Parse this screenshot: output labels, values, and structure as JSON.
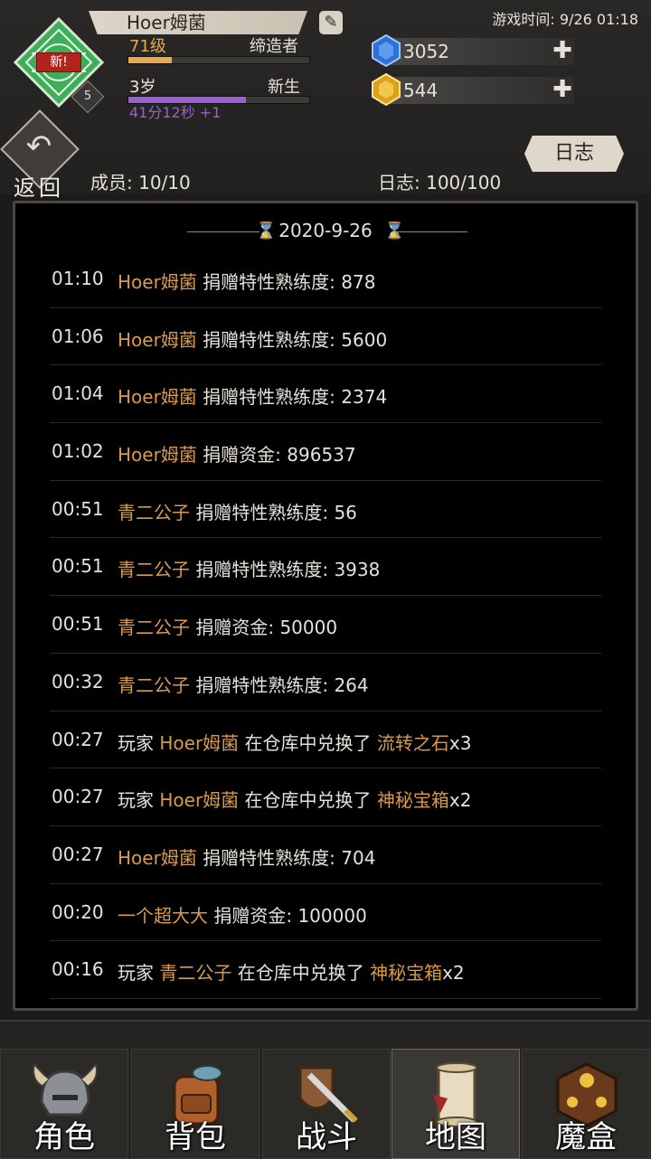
{
  "header": {
    "player_name": "Hoer姆菌",
    "emblem_tag": "新!",
    "rank": "5",
    "level": "71级",
    "title": "缔造者",
    "level_progress": 0.24,
    "age": "3岁",
    "stage": "新生",
    "age_progress": 0.65,
    "timer": "41分12秒 +1",
    "game_time": "游戏时间: 9/26 01:18",
    "blue_gem": "3052",
    "gold_gem": "544",
    "plus_symbol": "✚"
  },
  "toolbar": {
    "back_label": "返回",
    "members": "成员: 10/10",
    "log_count": "日志: 100/100",
    "log_tab": "日志"
  },
  "log": {
    "date": "2020-9-26",
    "entries": [
      {
        "time": "01:10",
        "pre": "",
        "name": "Hoer姆菌",
        "mid": " 捐赠特性熟练度: 878",
        "item": "",
        "post": ""
      },
      {
        "time": "01:06",
        "pre": "",
        "name": "Hoer姆菌",
        "mid": " 捐赠特性熟练度: 5600",
        "item": "",
        "post": ""
      },
      {
        "time": "01:04",
        "pre": "",
        "name": "Hoer姆菌",
        "mid": " 捐赠特性熟练度: 2374",
        "item": "",
        "post": ""
      },
      {
        "time": "01:02",
        "pre": "",
        "name": "Hoer姆菌",
        "mid": " 捐赠资金: 896537",
        "item": "",
        "post": ""
      },
      {
        "time": "00:51",
        "pre": "",
        "name": "青二公子",
        "mid": " 捐赠特性熟练度: 56",
        "item": "",
        "post": ""
      },
      {
        "time": "00:51",
        "pre": "",
        "name": "青二公子",
        "mid": " 捐赠特性熟练度: 3938",
        "item": "",
        "post": ""
      },
      {
        "time": "00:51",
        "pre": "",
        "name": "青二公子",
        "mid": " 捐赠资金: 50000",
        "item": "",
        "post": ""
      },
      {
        "time": "00:32",
        "pre": "",
        "name": "青二公子",
        "mid": " 捐赠特性熟练度: 264",
        "item": "",
        "post": ""
      },
      {
        "time": "00:27",
        "pre": "玩家 ",
        "name": "Hoer姆菌",
        "mid": " 在仓库中兑换了 ",
        "item": "流转之石",
        "post": "x3"
      },
      {
        "time": "00:27",
        "pre": "玩家 ",
        "name": "Hoer姆菌",
        "mid": " 在仓库中兑换了 ",
        "item": "神秘宝箱",
        "post": "x2"
      },
      {
        "time": "00:27",
        "pre": "",
        "name": "Hoer姆菌",
        "mid": " 捐赠特性熟练度: 704",
        "item": "",
        "post": ""
      },
      {
        "time": "00:20",
        "pre": "",
        "name": "一个超大大",
        "mid": " 捐赠资金: 100000",
        "item": "",
        "post": ""
      },
      {
        "time": "00:16",
        "pre": "玩家 ",
        "name": "青二公子",
        "mid": " 在仓库中兑换了 ",
        "item": "神秘宝箱",
        "post": "x2"
      }
    ]
  },
  "nav": {
    "items": [
      {
        "label": "角色",
        "icon": "helmet-icon"
      },
      {
        "label": "背包",
        "icon": "backpack-icon"
      },
      {
        "label": "战斗",
        "icon": "sword-shield-icon"
      },
      {
        "label": "地图",
        "icon": "scroll-map-icon"
      },
      {
        "label": "魔盒",
        "icon": "magic-box-icon"
      }
    ],
    "active_index": 3
  },
  "colors": {
    "highlight": "#d89a4c",
    "level_bar": "#e6a94d",
    "age_bar": "#9a5fd0",
    "emblem": "#3fae5a"
  }
}
